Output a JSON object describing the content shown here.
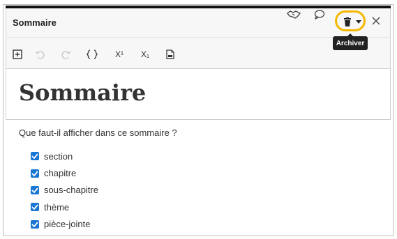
{
  "panel": {
    "title": "Sommaire",
    "tooltip": "Archiver"
  },
  "toolbar": {
    "superscript_label": "X¹",
    "subscript_label": "X₁"
  },
  "document": {
    "heading": "Sommaire",
    "question": "Que faut-il afficher dans ce sommaire ?"
  },
  "options": [
    {
      "label": "section",
      "checked": true
    },
    {
      "label": "chapitre",
      "checked": true
    },
    {
      "label": "sous-chapitre",
      "checked": true
    },
    {
      "label": "thème",
      "checked": true
    },
    {
      "label": "pièce-jointe",
      "checked": true
    }
  ],
  "colors": {
    "highlight": "#f5b800",
    "checkbox": "#1976d2",
    "tooltip_bg": "#222222"
  },
  "icons": {
    "handshake": "handshake-icon",
    "comment": "comment-icon",
    "trash": "trash-icon",
    "caret": "caret-down-icon",
    "close": "close-icon",
    "insert": "insert-box-icon",
    "undo": "undo-icon",
    "redo": "redo-icon",
    "braces": "braces-icon",
    "pdf": "pdf-icon"
  }
}
